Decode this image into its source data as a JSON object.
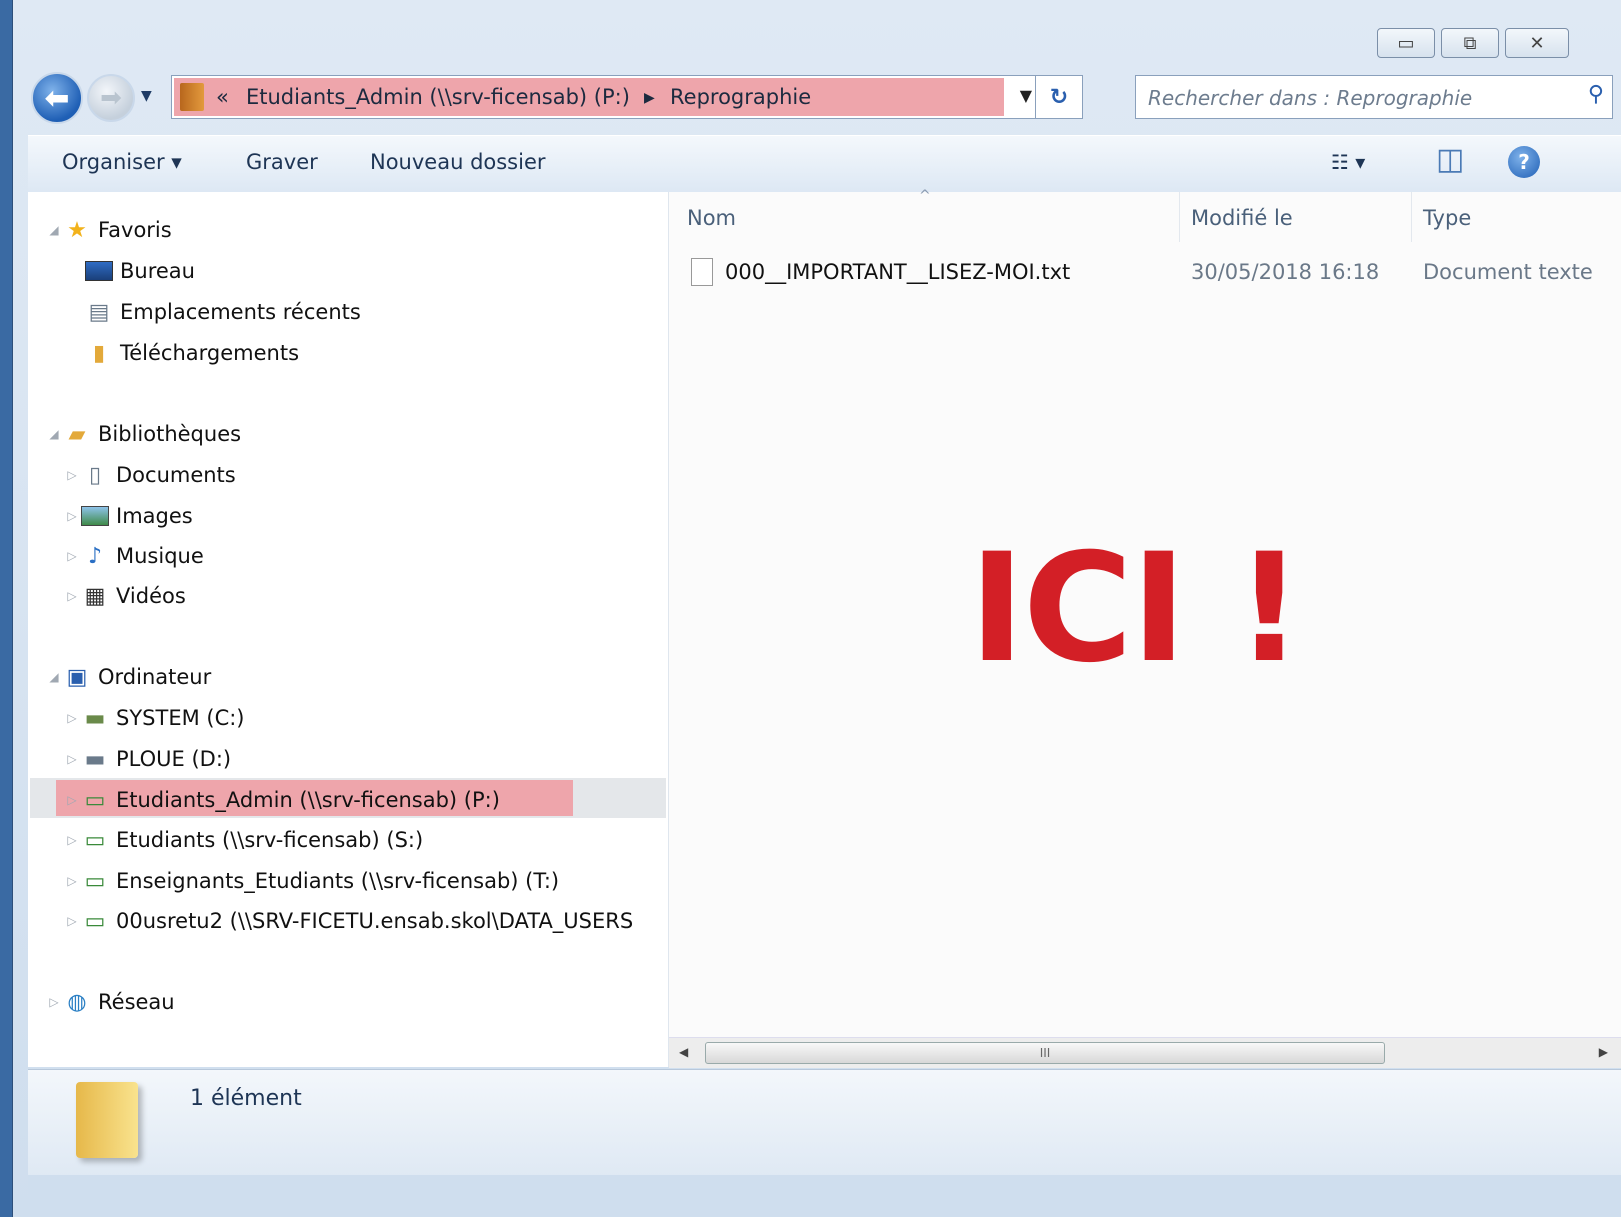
{
  "window": {
    "caption_buttons": {
      "minimize": "▭",
      "maximize": "⧉",
      "close": "✕"
    }
  },
  "nav": {
    "back_glyph": "⬅",
    "forward_glyph": "➡",
    "history_glyph": "▼",
    "address": {
      "overflow_glyph": "«",
      "segment_1": "Etudiants_Admin (\\\\srv-ficensab) (P:)",
      "separator_glyph": "▶",
      "segment_2": "Reprographie",
      "dropdown_glyph": "▼",
      "refresh_glyph": "↻"
    },
    "search": {
      "placeholder": "Rechercher dans : Reprographie",
      "value": "",
      "icon": "search-icon",
      "glyph": "⚲"
    }
  },
  "toolbar": {
    "organiser": "Organiser ▾",
    "graver": "Graver",
    "nouveau_dossier": "Nouveau dossier",
    "views_glyph": "☷ ▾",
    "preview_glyph": "◫",
    "help_glyph": "?"
  },
  "sidebar": {
    "favoris": {
      "label": "Favoris",
      "items": [
        "Bureau",
        "Emplacements récents",
        "Téléchargements"
      ]
    },
    "bibliotheques": {
      "label": "Bibliothèques",
      "items": [
        "Documents",
        "Images",
        "Musique",
        "Vidéos"
      ]
    },
    "ordinateur": {
      "label": "Ordinateur",
      "items": [
        "SYSTEM (C:)",
        "PLOUE (D:)",
        "Etudiants_Admin (\\\\srv-ficensab) (P:)",
        "Etudiants (\\\\srv-ficensab) (S:)",
        "Enseignants_Etudiants (\\\\srv-ficensab) (T:)",
        "00usretu2 (\\\\SRV-FICETU.ensab.skol\\DATA_USERS"
      ]
    },
    "reseau": {
      "label": "Réseau"
    },
    "arrows": {
      "expanded": "◢",
      "collapsed": "▷"
    }
  },
  "content": {
    "columns": {
      "name": "Nom",
      "modified": "Modifié le",
      "type": "Type",
      "sort_glyph": "^"
    },
    "files": [
      {
        "name": "000__IMPORTANT__LISEZ-MOI.txt",
        "modified": "30/05/2018 16:18",
        "type": "Document texte"
      }
    ],
    "overlay_text": "ICI !",
    "scroll": {
      "left_glyph": "◀",
      "right_glyph": "▶",
      "thumb_glyph": "III"
    }
  },
  "details": {
    "item_count": "1 élément"
  },
  "colors": {
    "highlight": "#eea5ab",
    "overlay_red": "#d31f26",
    "window_frame": "#3a6aa3"
  }
}
